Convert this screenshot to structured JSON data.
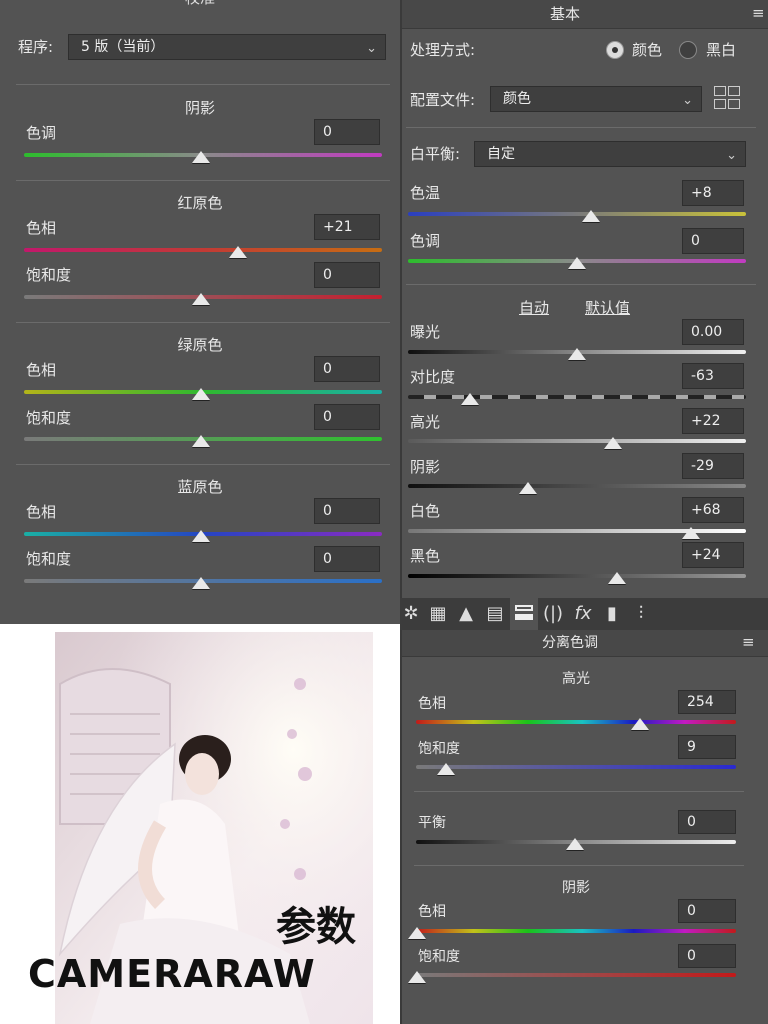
{
  "left_panel": {
    "top_partial_title": "校准",
    "process_label": "程序:",
    "process_value": "5 版（当前）",
    "shadow_section": {
      "title": "阴影",
      "tint_label": "色调",
      "tint_value": "0"
    },
    "red_primary": {
      "title": "红原色",
      "hue_label": "色相",
      "hue_value": "+21",
      "sat_label": "饱和度",
      "sat_value": "0"
    },
    "green_primary": {
      "title": "绿原色",
      "hue_label": "色相",
      "hue_value": "0",
      "sat_label": "饱和度",
      "sat_value": "0"
    },
    "blue_primary": {
      "title": "蓝原色",
      "hue_label": "色相",
      "hue_value": "0",
      "sat_label": "饱和度",
      "sat_value": "0"
    }
  },
  "basic_panel": {
    "title": "基本",
    "treatment_label": "处理方式:",
    "treatment_color": "颜色",
    "treatment_bw": "黑白",
    "profile_label": "配置文件:",
    "profile_value": "颜色",
    "wb_label": "白平衡:",
    "wb_value": "自定",
    "temp_label": "色温",
    "temp_value": "+8",
    "tint_label": "色调",
    "tint_value": "0",
    "auto_link": "自动",
    "default_link": "默认值",
    "exposure_label": "曝光",
    "exposure_value": "0.00",
    "contrast_label": "对比度",
    "contrast_value": "-63",
    "highlights_label": "高光",
    "highlights_value": "+22",
    "shadows_label": "阴影",
    "shadows_value": "-29",
    "whites_label": "白色",
    "whites_value": "+68",
    "blacks_label": "黑色",
    "blacks_value": "+24"
  },
  "split_panel": {
    "title": "分离色调",
    "highlights_title": "高光",
    "hl_hue_label": "色相",
    "hl_hue_value": "254",
    "hl_sat_label": "饱和度",
    "hl_sat_value": "9",
    "balance_label": "平衡",
    "balance_value": "0",
    "shadows_title": "阴影",
    "sh_hue_label": "色相",
    "sh_hue_value": "0",
    "sh_sat_label": "饱和度",
    "sh_sat_value": "0"
  },
  "overlay": {
    "caption_cn": "参数",
    "caption_en": "CAMERARAW"
  },
  "icons": [
    "aperture-icon",
    "grid-icon",
    "mountain-icon",
    "hsl-icon",
    "split-toning-icon",
    "lens-icon",
    "fx-icon",
    "film-icon",
    "sliders-icon"
  ]
}
